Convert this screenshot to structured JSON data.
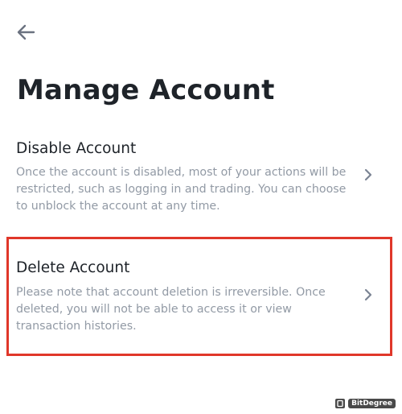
{
  "header": {
    "back_icon": "arrow-left-icon",
    "title": "Manage Account"
  },
  "options": [
    {
      "title": "Disable Account",
      "description": "Once the account is disabled, most of your actions will be restricted, such as logging in and trading. You can choose to unblock the account at any time.",
      "icon": "chevron-right-icon"
    },
    {
      "title": "Delete Account",
      "description": "Please note that account deletion is irreversible. Once deleted, you will not be able to access it or view transaction histories.",
      "icon": "chevron-right-icon",
      "highlighted": true,
      "highlight_color": "#e0372a"
    }
  ],
  "colors": {
    "title_text": "#1e2329",
    "description_text": "#929aa5",
    "icon": "#7b8494"
  },
  "watermark": {
    "text": "BitDegree"
  }
}
